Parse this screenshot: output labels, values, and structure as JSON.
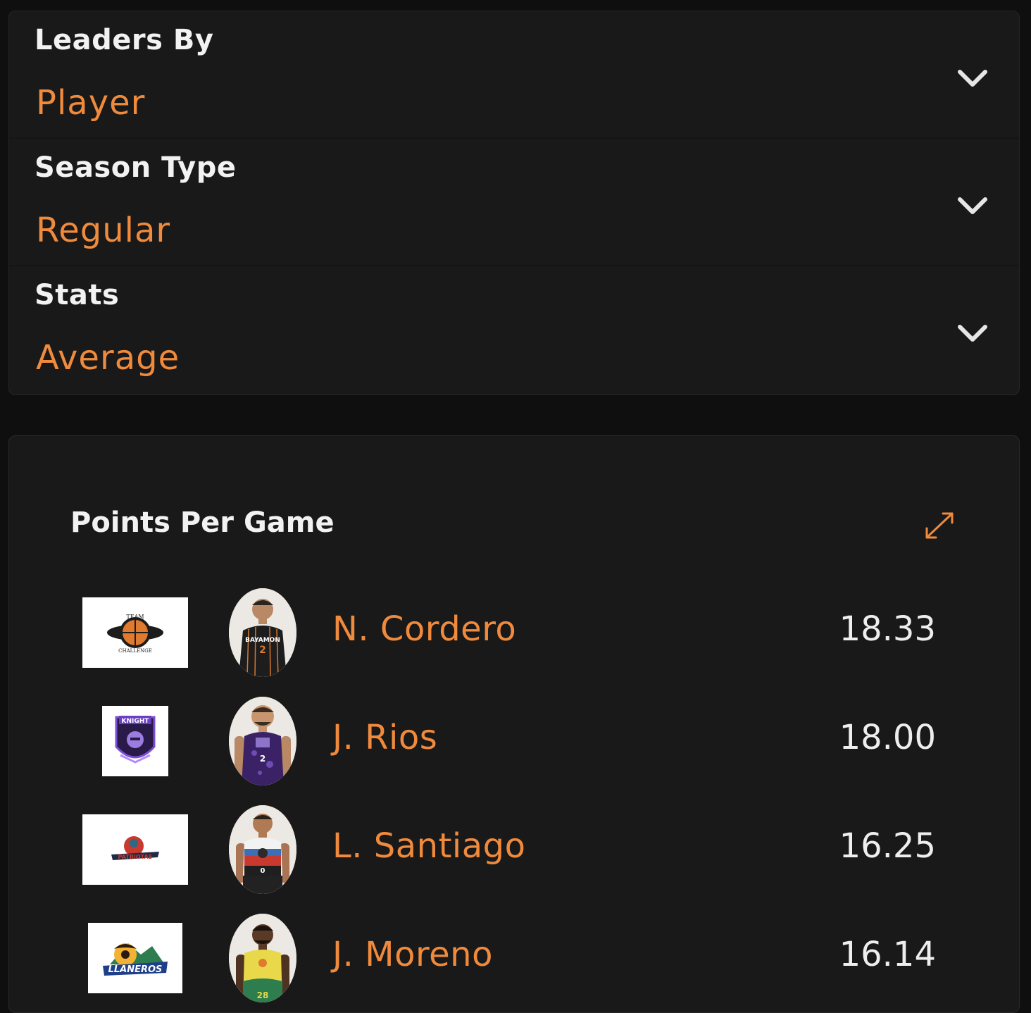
{
  "filters": [
    {
      "label": "Leaders By",
      "value": "Player"
    },
    {
      "label": "Season Type",
      "value": "Regular"
    },
    {
      "label": "Stats",
      "value": "Average"
    }
  ],
  "leaders": {
    "title": "Points Per Game",
    "rows": [
      {
        "team_logo": "team-challenge-logo",
        "name": "N. Cordero",
        "value": "18.33"
      },
      {
        "team_logo": "knights-logo",
        "name": "J. Rios",
        "value": "18.00"
      },
      {
        "team_logo": "patriotas-logo",
        "name": "L. Santiago",
        "value": "16.25"
      },
      {
        "team_logo": "llaneros-logo",
        "name": "J. Moreno",
        "value": "16.14"
      }
    ]
  },
  "colors": {
    "accent": "#f08a3c",
    "panel": "#191919",
    "background": "#0f0f0f",
    "text": "#f2f2f2"
  }
}
